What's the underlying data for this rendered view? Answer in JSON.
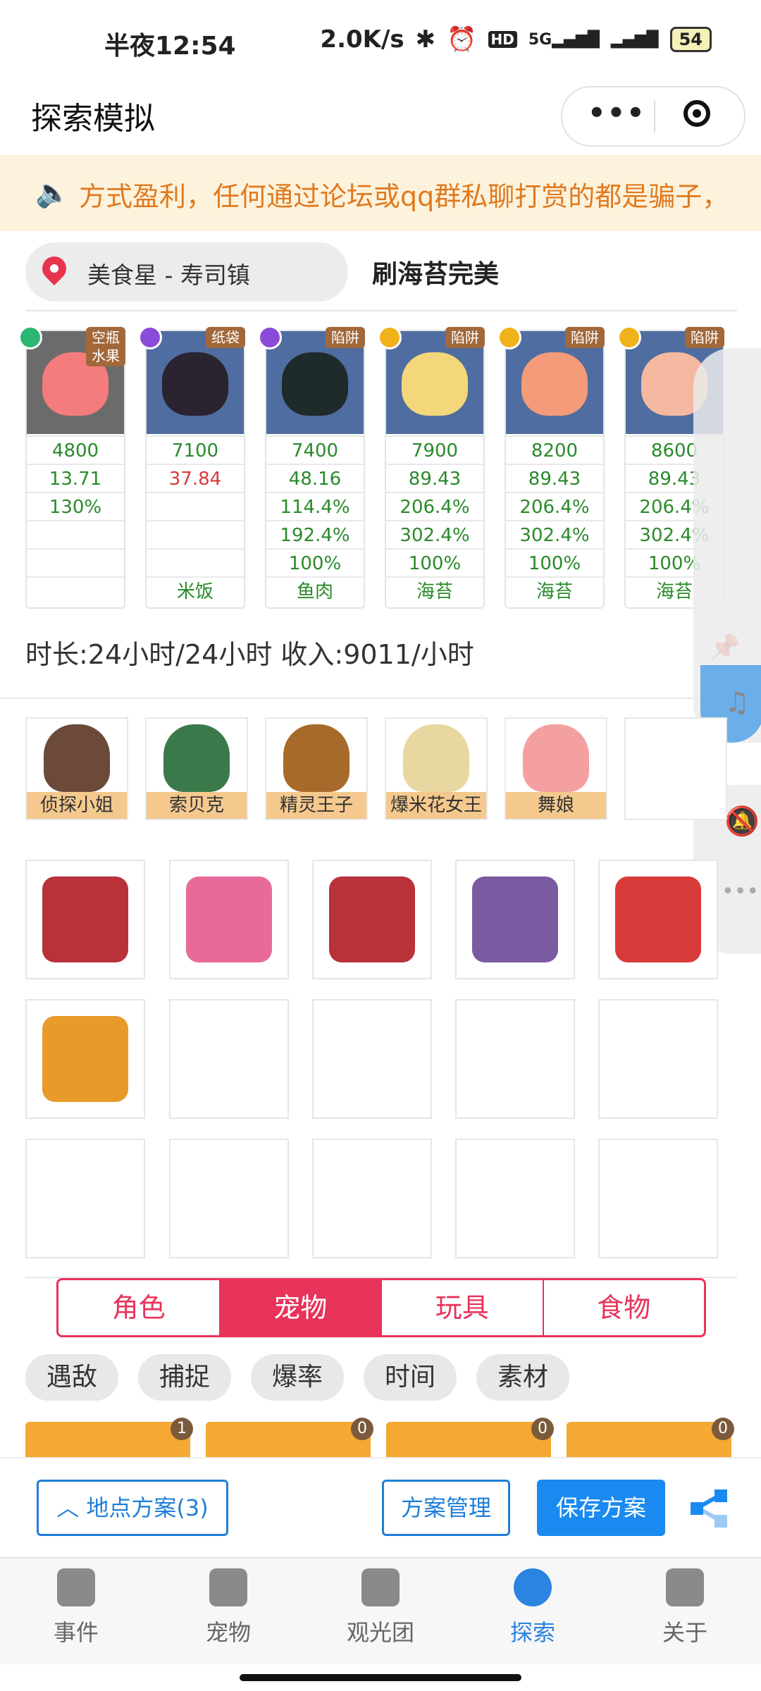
{
  "status_bar": {
    "time": "半夜12:54",
    "net_speed": "2.0K/s",
    "hd": "HD",
    "signal": "5G",
    "battery": "54"
  },
  "title_bar": {
    "title": "探索模拟"
  },
  "notice": {
    "text": "方式盈利，任何通过论坛或qq群私聊打赏的都是骗子，"
  },
  "location": {
    "name": "美食星 - 寿司镇",
    "plan_name": "刷海苔完美"
  },
  "pets": [
    {
      "badge": "空瓶\n水果",
      "type_color": "#2bb673",
      "img_color": "#f47c7c",
      "bg": "#6b6b6b",
      "rows": [
        "4800",
        "13.71",
        "130%",
        "",
        "",
        ""
      ],
      "red_row": -1
    },
    {
      "badge": "纸袋",
      "type_color": "#8a4cd8",
      "img_color": "#2a2330",
      "bg": "#4f6da0",
      "rows": [
        "7100",
        "37.84",
        "",
        "",
        "",
        "米饭"
      ],
      "red_row": 1
    },
    {
      "badge": "陷阱",
      "type_color": "#8a4cd8",
      "img_color": "#1f2a2a",
      "bg": "#4f6da0",
      "rows": [
        "7400",
        "48.16",
        "114.4%",
        "192.4%",
        "100%",
        "鱼肉"
      ],
      "red_row": -1
    },
    {
      "badge": "陷阱",
      "type_color": "#f0b21a",
      "img_color": "#f4d77a",
      "bg": "#4f6da0",
      "rows": [
        "7900",
        "89.43",
        "206.4%",
        "302.4%",
        "100%",
        "海苔"
      ],
      "red_row": -1
    },
    {
      "badge": "陷阱",
      "type_color": "#f0b21a",
      "img_color": "#f49b7a",
      "bg": "#4f6da0",
      "rows": [
        "8200",
        "89.43",
        "206.4%",
        "302.4%",
        "100%",
        "海苔"
      ],
      "red_row": -1
    },
    {
      "badge": "陷阱",
      "type_color": "#f0b21a",
      "img_color": "#f4b9a0",
      "bg": "#4f6da0",
      "rows": [
        "8600",
        "89.43",
        "206.4%",
        "302.4%",
        "100%",
        "海苔"
      ],
      "red_row": -1
    }
  ],
  "duration_text": "时长:24小时/24小时 收入:9011/小时",
  "characters": [
    {
      "name": "侦探小姐",
      "color": "#6b4a3a"
    },
    {
      "name": "索贝克",
      "color": "#3a7a4a"
    },
    {
      "name": "精灵王子",
      "color": "#a86a2a"
    },
    {
      "name": "爆米花女王",
      "color": "#e8d7a0"
    },
    {
      "name": "舞娘",
      "color": "#f4a0a0"
    },
    {
      "name": "",
      "color": ""
    }
  ],
  "items": [
    {
      "name": "bento-box",
      "color": "#b8323a"
    },
    {
      "name": "flower-badge",
      "color": "#e86a9a"
    },
    {
      "name": "bento-box",
      "color": "#b8323a"
    },
    {
      "name": "blender",
      "color": "#7a5aa0"
    },
    {
      "name": "red-wallet",
      "color": "#d83a3a"
    },
    {
      "name": "flashlight",
      "color": "#e89a2a"
    },
    {
      "name": "",
      "color": ""
    },
    {
      "name": "",
      "color": ""
    },
    {
      "name": "",
      "color": ""
    },
    {
      "name": "",
      "color": ""
    },
    {
      "name": "",
      "color": ""
    },
    {
      "name": "",
      "color": ""
    },
    {
      "name": "",
      "color": ""
    },
    {
      "name": "",
      "color": ""
    },
    {
      "name": "",
      "color": ""
    }
  ],
  "tabs": [
    {
      "label": "角色"
    },
    {
      "label": "宠物"
    },
    {
      "label": "玩具"
    },
    {
      "label": "食物"
    }
  ],
  "active_tab": 1,
  "chips": [
    {
      "label": "遇敌"
    },
    {
      "label": "捕捉"
    },
    {
      "label": "爆率"
    },
    {
      "label": "时间"
    },
    {
      "label": "素材"
    }
  ],
  "pet_counts": [
    "1",
    "0",
    "0",
    "0"
  ],
  "action_bar": {
    "location_plans": "地点方案(3)",
    "manage": "方案管理",
    "save": "保存方案"
  },
  "bottom_nav": [
    {
      "label": "事件",
      "icon": "flag-icon"
    },
    {
      "label": "宠物",
      "icon": "pet-icon"
    },
    {
      "label": "观光团",
      "icon": "tour-icon"
    },
    {
      "label": "探索",
      "icon": "explore-icon"
    },
    {
      "label": "关于",
      "icon": "about-icon"
    }
  ],
  "active_nav": 3,
  "colors": {
    "accent": "#e8335a",
    "primary": "#1a8af0",
    "notice_text": "#e07a1f",
    "notice_bg": "#fdf3dd",
    "label_bg": "#f5c98d"
  }
}
